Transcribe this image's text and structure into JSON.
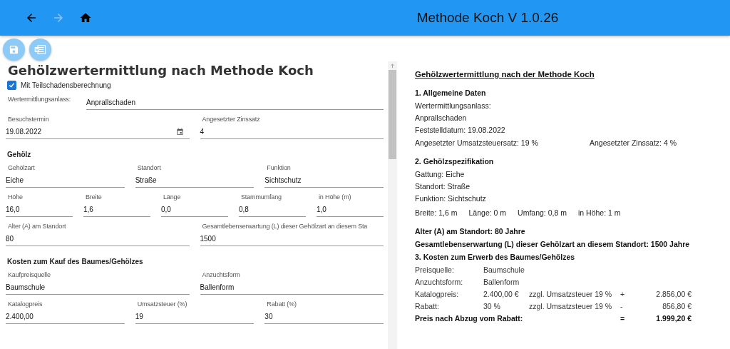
{
  "header": {
    "title": "Methode Koch V 1.0.26",
    "nav": [
      {
        "kind": "back",
        "disabled": false
      },
      {
        "kind": "forward",
        "disabled": true
      },
      {
        "kind": "home",
        "disabled": false
      }
    ]
  },
  "actions": [
    {
      "kind": "save"
    },
    {
      "kind": "word"
    }
  ],
  "form": {
    "title": "Gehölzwertermittlung nach Methode Koch",
    "checkbox": {
      "label": "Mit Teilschadensberechnung",
      "checked": true
    },
    "rows": [
      {
        "kind": "inline",
        "fields": [
          {
            "label": "Wertermittlungsanlass:",
            "value": "Anprallschaden"
          }
        ]
      },
      {
        "kind": "fields",
        "fields": [
          {
            "label": "Besuchstermin",
            "value": "19.08.2022",
            "kind": "date"
          },
          {
            "label": "Angesetzter Zinssatz",
            "value": "4",
            "kind": "text"
          }
        ]
      },
      {
        "kind": "heading",
        "text": "Gehölz"
      },
      {
        "kind": "fields",
        "fields": [
          {
            "label": "Gehölzart",
            "value": "Eiche",
            "kind": "text"
          },
          {
            "label": "Standort",
            "value": "Straße",
            "kind": "text"
          },
          {
            "label": "Funktion",
            "value": "Sichtschutz",
            "kind": "text"
          }
        ]
      },
      {
        "kind": "fields",
        "fields": [
          {
            "label": "Höhe",
            "value": "16,0",
            "kind": "text"
          },
          {
            "label": "Breite",
            "value": "1,6",
            "kind": "text"
          },
          {
            "label": "Länge",
            "value": "0,0",
            "kind": "text"
          },
          {
            "label": "Stammumfang",
            "value": "0,8",
            "kind": "text"
          },
          {
            "label": "in Höhe (m)",
            "value": "1,0",
            "kind": "text"
          }
        ]
      },
      {
        "kind": "fields",
        "fields": [
          {
            "label": "Alter (A) am Standort",
            "value": "80",
            "kind": "text"
          },
          {
            "label": "Gesamtlebenserwartung (L) dieser Gehölzart   an diesem Sta",
            "value": "1500",
            "kind": "text"
          }
        ]
      },
      {
        "kind": "heading",
        "text": "Kosten zum Kauf des Baumes/Gehölzes"
      },
      {
        "kind": "fields",
        "fields": [
          {
            "label": "Kaufpreisquelle",
            "value": "Baumschule",
            "kind": "text"
          },
          {
            "label": "Anzuchtsform",
            "value": "Ballenform",
            "kind": "text"
          }
        ]
      },
      {
        "kind": "fields",
        "fields": [
          {
            "label": "Katalogpreis",
            "value": "2.400,00",
            "kind": "text"
          },
          {
            "label": "Umsatzsteuer (%)",
            "value": "19",
            "kind": "text"
          },
          {
            "label": "Rabatt (%)",
            "value": "30",
            "kind": "text"
          }
        ]
      }
    ]
  },
  "report": [
    {
      "kind": "title",
      "text": "Gehölzwertermittlung nach der Methode Koch"
    },
    {
      "kind": "heading",
      "text": "1. Allgemeine Daten"
    },
    {
      "kind": "line",
      "text": "Wertermittlungsanlass:"
    },
    {
      "kind": "line",
      "text": "Anprallschaden"
    },
    {
      "kind": "line",
      "text": "Feststelldatum: 19.08.2022"
    },
    {
      "kind": "pair",
      "texts": [
        "Angesetzter Umsatzsteuersatz: 19 %",
        "Angesetzter Zinssatz: 4 %"
      ]
    },
    {
      "kind": "heading",
      "text": "2. Gehölzspezifikation"
    },
    {
      "kind": "line",
      "text": "Gattung: Eiche"
    },
    {
      "kind": "line",
      "text": "Standort: Straße"
    },
    {
      "kind": "line",
      "text": "Funktion: Sichtschutz"
    },
    {
      "kind": "dims",
      "texts": [
        "Breite: 1,6 m",
        "Länge: 0 m",
        "Umfang: 0,8 m",
        "in Höhe: 1 m"
      ]
    },
    {
      "kind": "strong",
      "text": "Alter (A) am Standort: 80 Jahre"
    },
    {
      "kind": "strong",
      "text": "Gesamtlebenserwartung (L) dieser Gehölzart an diesem Standort: 1500 Jahre"
    },
    {
      "kind": "heading",
      "text": "3. Kosten zum Erwerb des Baumes/Gehölzes"
    },
    {
      "kind": "cost",
      "cells": [
        "Preisquelle:",
        "Baumschule"
      ]
    },
    {
      "kind": "cost",
      "cells": [
        "Anzuchtsform:",
        "Ballenform"
      ]
    },
    {
      "kind": "cost",
      "cells": [
        "Katalogpreis:",
        "2.400,00 €",
        "zzgl. Umsatzsteuer 19 %",
        "+",
        "2.856,00 €"
      ]
    },
    {
      "kind": "cost",
      "cells": [
        "Rabatt:",
        "30 %",
        "zzgl. Umsatzsteuer 19 %",
        "-",
        "856,80 €"
      ]
    },
    {
      "kind": "total",
      "cells": [
        "Preis nach Abzug vom Rabatt:",
        "=",
        "1.999,20 €"
      ]
    }
  ]
}
